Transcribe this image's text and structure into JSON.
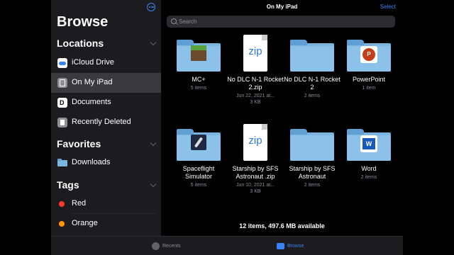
{
  "sidebar": {
    "title": "Browse",
    "more_icon": "ellipsis-circle-icon",
    "locations_header": "Locations",
    "locations": [
      {
        "label": "iCloud Drive",
        "icon": "icloud-icon"
      },
      {
        "label": "On My iPad",
        "icon": "ipad-icon",
        "selected": true
      },
      {
        "label": "Documents",
        "icon": "documents-app-icon"
      },
      {
        "label": "Recently Deleted",
        "icon": "trash-icon"
      }
    ],
    "favorites_header": "Favorites",
    "favorites": [
      {
        "label": "Downloads",
        "icon": "folder-icon"
      }
    ],
    "tags_header": "Tags",
    "tags": [
      {
        "label": "Red",
        "color": "#ff3b30"
      },
      {
        "label": "Orange",
        "color": "#ff9500"
      }
    ]
  },
  "main": {
    "title": "On My iPad",
    "select_label": "Select",
    "search_placeholder": "Search",
    "items": [
      {
        "name": "MC+",
        "meta1": "5 items",
        "meta2": "",
        "kind": "folder",
        "badge": "minecraft"
      },
      {
        "name": "No DLC N-1 Rocket 2.zip",
        "meta1": "Jun 22, 2021 at...",
        "meta2": "3 KB",
        "kind": "zip",
        "zip_label": "zip"
      },
      {
        "name": "No DLC N-1 Rocket 2",
        "meta1": "2 items",
        "meta2": "",
        "kind": "folder"
      },
      {
        "name": "PowerPoint",
        "meta1": "1 item",
        "meta2": "",
        "kind": "folder",
        "badge": "powerpoint",
        "badge_letter": "P"
      },
      {
        "name": "Spaceflight Simulator",
        "meta1": "5 items",
        "meta2": "",
        "kind": "folder",
        "badge": "rocket"
      },
      {
        "name": "Starship by SFS Astronaut .zip",
        "meta1": "Jun 10, 2021 at...",
        "meta2": "3 KB",
        "kind": "zip",
        "zip_label": "zip"
      },
      {
        "name": "Starship by SFS Astronaut",
        "meta1": "2 items",
        "meta2": "",
        "kind": "folder"
      },
      {
        "name": "Word",
        "meta1": "2 items",
        "meta2": "",
        "kind": "folder",
        "badge": "word",
        "badge_letter": "W"
      }
    ],
    "summary": "12 items, 497.6 MB available"
  },
  "tabbar": {
    "recents_label": "Recents",
    "browse_label": "Browse",
    "accent": "#3a82f7"
  }
}
